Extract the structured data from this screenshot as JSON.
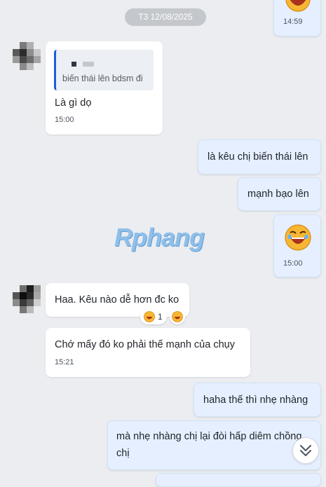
{
  "date_separator": "T3 12/08/2025",
  "watermark": "Rphang",
  "messages": [
    {
      "side": "out",
      "emoji": "laughing-emoji",
      "time": "14:59"
    },
    {
      "side": "in",
      "quote_text": "biến thái lên bdsm đi",
      "text": "Là gì dọ",
      "time": "15:00"
    },
    {
      "side": "out",
      "text": "là kêu chị biến thái lên"
    },
    {
      "side": "out",
      "text": "mạnh bạo lên"
    },
    {
      "side": "out",
      "emoji": "laughing-emoji",
      "time": "15:00"
    },
    {
      "side": "in",
      "text": "Haa. Kêu nào dễ hơn đc ko",
      "reaction_count": "1"
    },
    {
      "side": "in",
      "text": "Chớ mấy đó ko phải thế mạnh của chụy",
      "time": "15:21"
    },
    {
      "side": "out",
      "text": "haha thế thì nhẹ nhàng"
    },
    {
      "side": "out",
      "text_line1": "mà nhẹ nhàng chị lại đòi hấp diêm chồng",
      "text_line2": "chị"
    }
  ],
  "colors": {
    "background": "#ebedf0",
    "incoming_bubble": "#ffffff",
    "outgoing_bubble": "#e5efff",
    "quote_bar": "#1a5fd6"
  },
  "icons": {
    "scroll_down": "double-chevron-down-icon",
    "reaction": "laughing-emoji"
  }
}
